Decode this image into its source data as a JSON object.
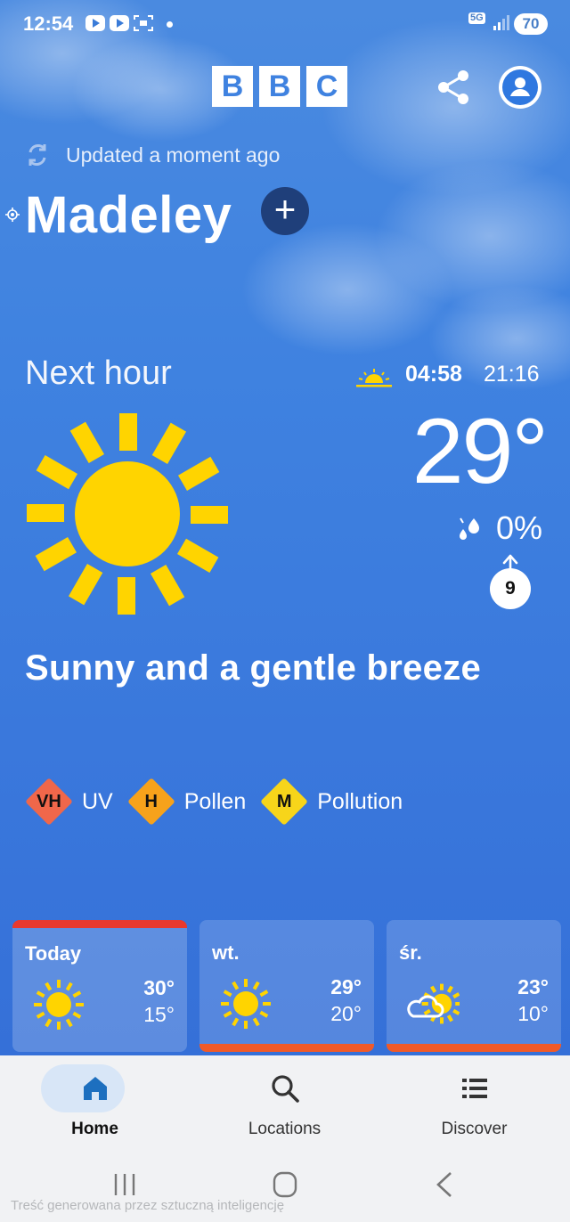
{
  "status_bar": {
    "time": "12:54",
    "network": "5G",
    "battery": "70",
    "icons": [
      "youtube-icon",
      "youtube-icon",
      "screenshot-icon",
      "notification-dot",
      "signal-icon"
    ]
  },
  "header": {
    "logo_letters": [
      "B",
      "B",
      "C"
    ],
    "share_icon": "share-icon",
    "profile_icon": "account-icon"
  },
  "location": {
    "updated": "Updated a moment ago",
    "name": "Madeley",
    "add_label": "+"
  },
  "next_hour": {
    "label": "Next hour",
    "sunrise": "04:58",
    "sunset": "21:16",
    "temperature": "29°",
    "rain_chance": "0%",
    "wind_speed": "9",
    "summary": "Sunny and a gentle breeze",
    "weather_icon": "sun-icon"
  },
  "indices": [
    {
      "code": "VH",
      "label": "UV",
      "color": "#f0674a"
    },
    {
      "code": "H",
      "label": "Pollen",
      "color": "#f7a21b"
    },
    {
      "code": "M",
      "label": "Pollution",
      "color": "#f7d51a"
    }
  ],
  "forecast": [
    {
      "day": "Today",
      "max": "30°",
      "min": "15°",
      "icon": "sun-icon"
    },
    {
      "day": "wt.",
      "max": "29°",
      "min": "20°",
      "icon": "sun-icon"
    },
    {
      "day": "śr.",
      "max": "23°",
      "min": "10°",
      "icon": "sun-cloud-icon"
    }
  ],
  "nav": {
    "home": "Home",
    "locations": "Locations",
    "discover": "Discover"
  },
  "system": {
    "ai_note": "Treść generowana przez sztuczną inteligencję"
  },
  "colors": {
    "sky": "#3f82e0",
    "sun": "#ffd400",
    "today_accent": "#e8392d",
    "card_bar": "#f05a28"
  }
}
